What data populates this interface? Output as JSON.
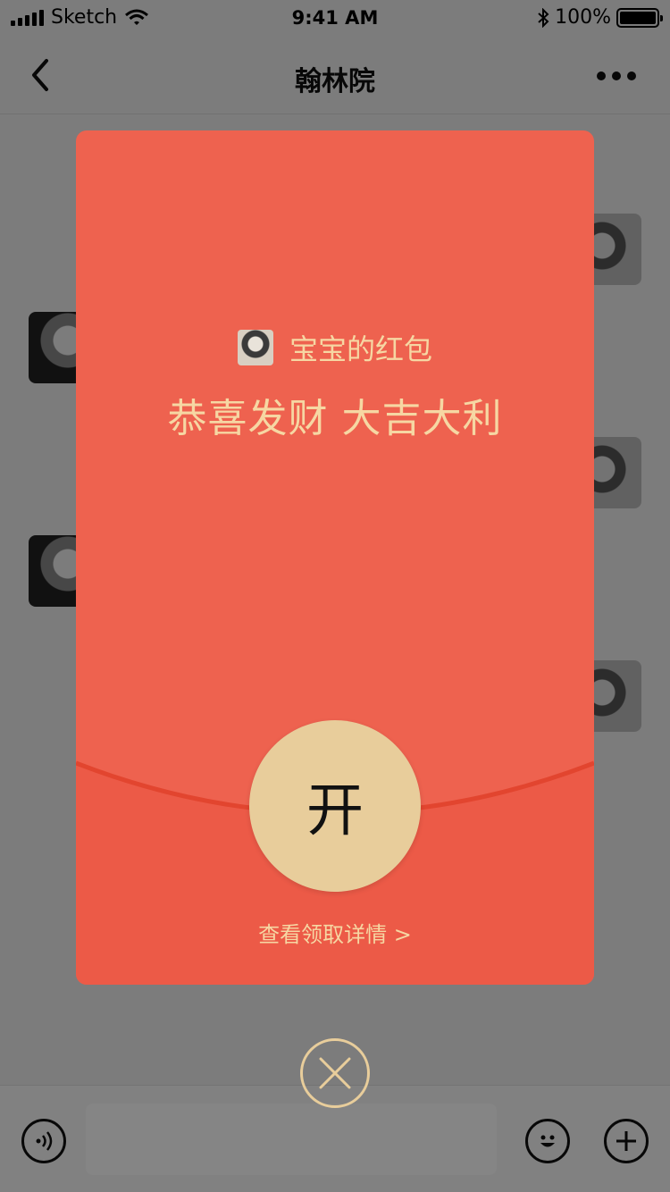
{
  "status_bar": {
    "carrier": "Sketch",
    "time": "9:41 AM",
    "battery": "100%"
  },
  "nav": {
    "title": "翰林院",
    "back_icon": "chevron-left-icon",
    "more_icon": "more-dots-icon"
  },
  "red_packet": {
    "sender_name": "宝宝的红包",
    "greeting": "恭喜发财 大吉大利",
    "open_label": "开",
    "details_link": "查看领取详情 >"
  },
  "colors": {
    "packet_red": "#ee624f",
    "gold": "#e8cd9b",
    "gold_text": "#f6d7a3"
  },
  "icons": {
    "close": "close-circle-icon",
    "voice": "voice-icon",
    "emoji": "emoji-icon",
    "add": "plus-circle-icon"
  }
}
